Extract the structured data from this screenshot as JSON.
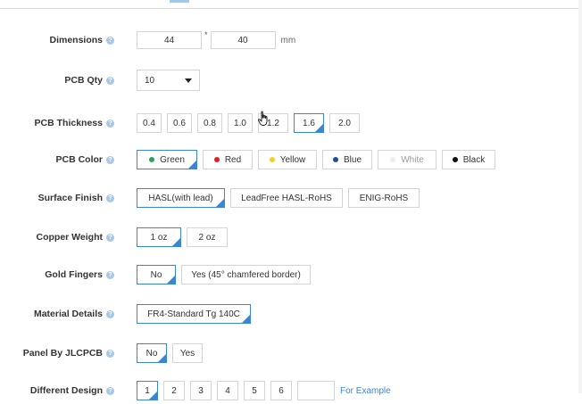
{
  "dimensions": {
    "label": "Dimensions",
    "width": "44",
    "sep": "*",
    "height": "40",
    "unit": "mm"
  },
  "pcb_qty": {
    "label": "PCB Qty",
    "value": "10"
  },
  "pcb_thickness": {
    "label": "PCB Thickness",
    "options": [
      "0.4",
      "0.6",
      "0.8",
      "1.0",
      "1.2",
      "1.6",
      "2.0"
    ],
    "selected": "1.6"
  },
  "pcb_color": {
    "label": "PCB Color",
    "options": [
      {
        "label": "Green",
        "color": "#2e9e5b"
      },
      {
        "label": "Red",
        "color": "#e02020"
      },
      {
        "label": "Yellow",
        "color": "#f2d21b"
      },
      {
        "label": "Blue",
        "color": "#1d4f9c"
      },
      {
        "label": "White",
        "color": "#eeeeee"
      },
      {
        "label": "Black",
        "color": "#111111"
      }
    ],
    "selected": "Green"
  },
  "surface_finish": {
    "label": "Surface Finish",
    "options": [
      "HASL(with lead)",
      "LeadFree HASL-RoHS",
      "ENIG-RoHS"
    ],
    "selected": "HASL(with lead)"
  },
  "copper_weight": {
    "label": "Copper Weight",
    "options": [
      "1 oz",
      "2 oz"
    ],
    "selected": "1 oz"
  },
  "gold_fingers": {
    "label": "Gold Fingers",
    "options": [
      "No",
      "Yes (45° chamfered border)"
    ],
    "selected": "No"
  },
  "material_details": {
    "label": "Material Details",
    "value": "FR4-Standard Tg 140C"
  },
  "panel": {
    "label": "Panel By JLCPCB",
    "options": [
      "No",
      "Yes"
    ],
    "selected": "No"
  },
  "different_design": {
    "label": "Different Design",
    "options": [
      "1",
      "2",
      "3",
      "4",
      "5",
      "6"
    ],
    "selected": "1",
    "custom_value": "",
    "link": "For Example"
  },
  "help_glyph": "?",
  "accent_color": "#3a86d6"
}
